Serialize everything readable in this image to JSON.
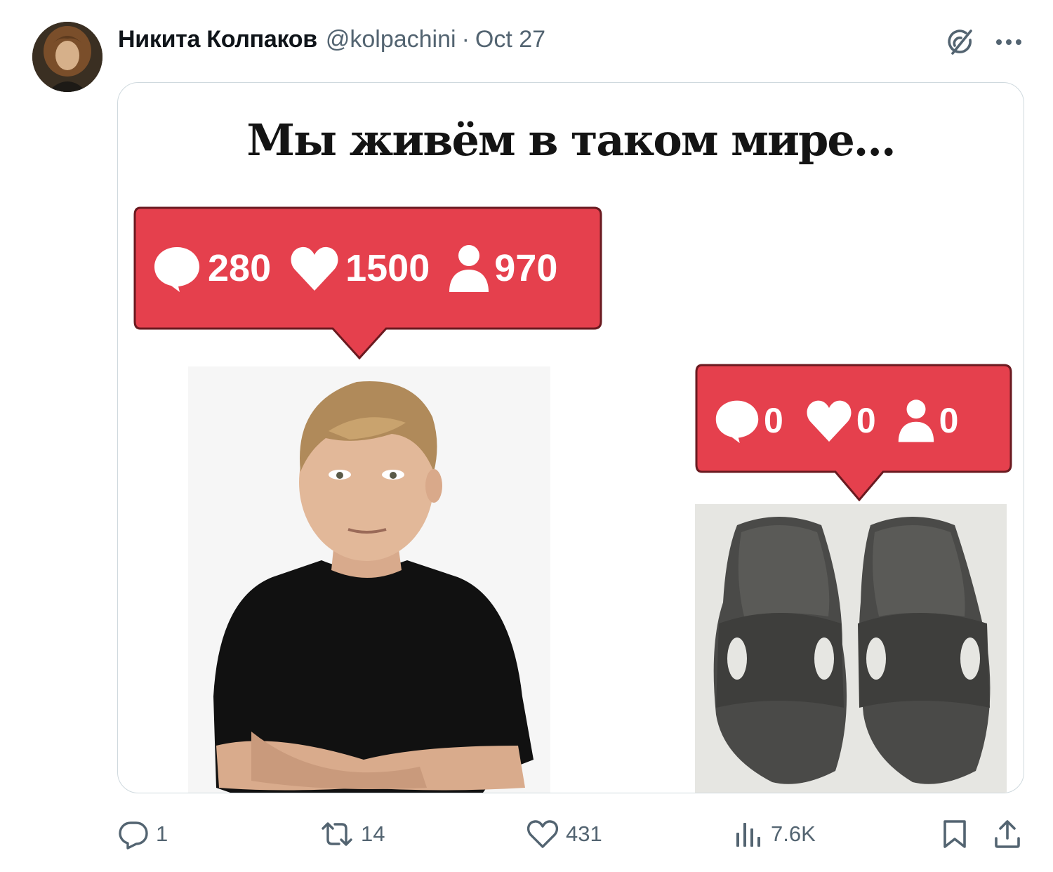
{
  "author": {
    "name": "Никита Колпаков",
    "handle": "@kolpachini",
    "separator": "·",
    "date": "Oct 27"
  },
  "meme": {
    "title": "Мы живём в таком мире...",
    "left_badge": {
      "comments": "280",
      "likes": "1500",
      "followers": "970"
    },
    "right_badge": {
      "comments": "0",
      "likes": "0",
      "followers": "0"
    },
    "badge_color": "#e5404d"
  },
  "actions": {
    "replies": "1",
    "reposts": "14",
    "likes": "431",
    "views": "7.6K"
  },
  "colors": {
    "text": "#0f1419",
    "secondary": "#536471",
    "border": "#cfd9de"
  },
  "icons": [
    "grok-icon",
    "more-icon",
    "reply-icon",
    "repost-icon",
    "like-icon",
    "views-icon",
    "bookmark-icon",
    "share-icon"
  ]
}
